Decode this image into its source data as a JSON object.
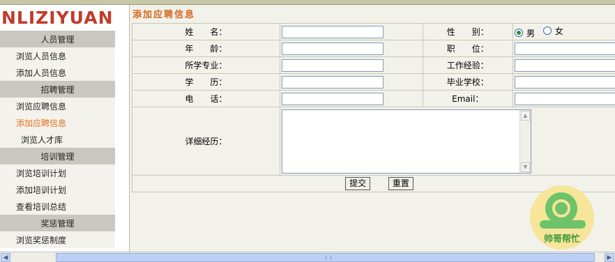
{
  "logo_text": "NLIZIYUAN",
  "sidebar": {
    "sections": [
      {
        "header": "人员管理",
        "items": [
          "浏览人员信息",
          "添加人员信息"
        ]
      },
      {
        "header": "招聘管理",
        "items": [
          "浏览应聘信息",
          "添加应聘信息",
          "浏览人才库"
        ]
      },
      {
        "header": "培训管理",
        "items": [
          "浏览培训计划",
          "添加培训计划",
          "查看培训总结"
        ]
      },
      {
        "header": "奖惩管理",
        "items": [
          "浏览奖惩制度"
        ]
      }
    ],
    "active_item": "添加应聘信息"
  },
  "page_title": "添加应聘信息",
  "form": {
    "name_label": "姓　　名：",
    "gender_label": "性　　别：",
    "gender_options": [
      "男",
      "女"
    ],
    "gender_selected": "男",
    "age_label": "年　　龄：",
    "position_label": "职　　位：",
    "major_label": "所学专业：",
    "experience_label": "工作经验：",
    "education_label": "学　　历：",
    "school_label": "毕业学校：",
    "phone_label": "电　　话：",
    "email_label": "Email：",
    "resume_label": "详细经历：",
    "submit_label": "提交",
    "reset_label": "重置"
  },
  "watermark_text": "帅哥帮忙",
  "colors": {
    "logo": "#c23a2a",
    "title": "#d2691e",
    "active_menu": "#e0731c",
    "menu_header_bg": "#c9c8c0",
    "content_bg": "#f2f1ea"
  }
}
